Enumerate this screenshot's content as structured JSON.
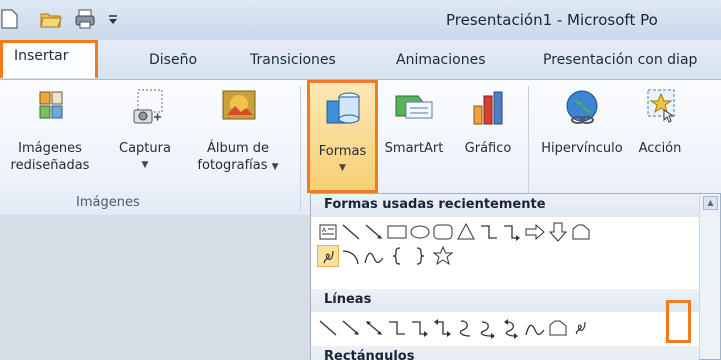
{
  "window": {
    "title": "Presentación1 - Microsoft Po"
  },
  "tabs": [
    "Insertar",
    "Diseño",
    "Transiciones",
    "Animaciones",
    "Presentación con diap"
  ],
  "ribbon": {
    "imagenes": {
      "line1": "Imágenes",
      "line2": "rediseñadas"
    },
    "captura": {
      "line1": "Captura"
    },
    "album": {
      "line1": "Álbum de",
      "line2": "fotografías"
    },
    "formas": {
      "label": "Formas"
    },
    "smartart": {
      "label": "SmartArt"
    },
    "grafico": {
      "label": "Gráfico"
    },
    "hipervinculo": {
      "label": "Hipervínculo"
    },
    "accion": {
      "label": "Acción"
    },
    "group_imagenes": "Imágenes"
  },
  "gallery": {
    "recent_header": "Formas usadas recientemente",
    "lines_header": "Líneas",
    "rect_header": "Rectángulos"
  },
  "colors": {
    "highlight": "#f07c22",
    "accent": "#2a5fa8"
  }
}
